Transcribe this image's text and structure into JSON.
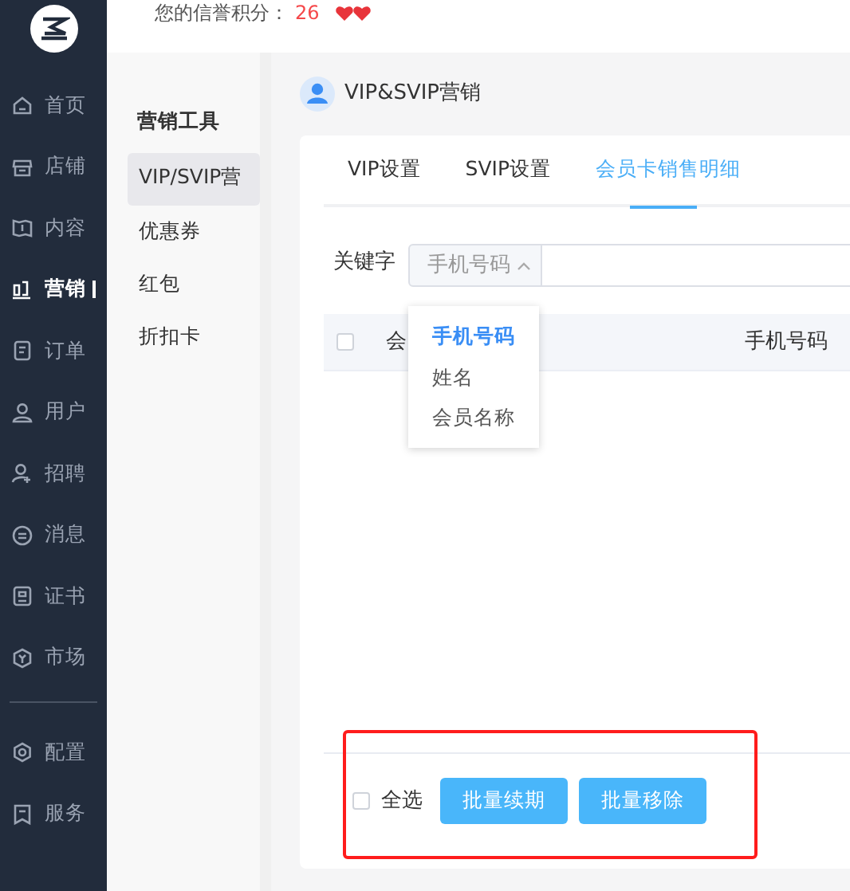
{
  "sidebar": {
    "items": [
      {
        "label": "首页",
        "selected": false
      },
      {
        "label": "店铺",
        "selected": false
      },
      {
        "label": "内容",
        "selected": false
      },
      {
        "label": "营销",
        "selected": true
      },
      {
        "label": "订单",
        "selected": false
      },
      {
        "label": "用户",
        "selected": false
      },
      {
        "label": "招聘",
        "selected": false
      },
      {
        "label": "消息",
        "selected": false
      },
      {
        "label": "证书",
        "selected": false
      },
      {
        "label": "市场",
        "selected": false
      }
    ],
    "bottom_items": [
      {
        "label": "配置",
        "selected": false
      },
      {
        "label": "服务",
        "selected": false
      }
    ]
  },
  "top_bar": {
    "credit_label": "您的信誉积分：",
    "credit_value": "26"
  },
  "sub_nav": {
    "title": "营销工具",
    "items": [
      {
        "label": "VIP/SVIP营",
        "selected": true
      },
      {
        "label": "优惠券",
        "selected": false
      },
      {
        "label": "红包",
        "selected": false
      },
      {
        "label": "折扣卡",
        "selected": false
      }
    ]
  },
  "page_title": "VIP&SVIP营销",
  "tabs": [
    {
      "label": "VIP设置",
      "selected": false
    },
    {
      "label": "SVIP设置",
      "selected": false
    },
    {
      "label": "会员卡销售明细",
      "selected": true
    }
  ],
  "filter": {
    "label": "关键字",
    "select_value": "手机号码",
    "dropdown_open": true,
    "options": [
      {
        "label": "手机号码",
        "selected": true
      },
      {
        "label": "姓名",
        "selected": false
      },
      {
        "label": "会员名称",
        "selected": false
      }
    ]
  },
  "table": {
    "select_all_checked": false,
    "columns": [
      "会",
      "手机号码"
    ]
  },
  "footer": {
    "select_all_label": "全选",
    "checked": false,
    "buttons": [
      "批量续期",
      "批量移除"
    ],
    "highlighted": true
  }
}
